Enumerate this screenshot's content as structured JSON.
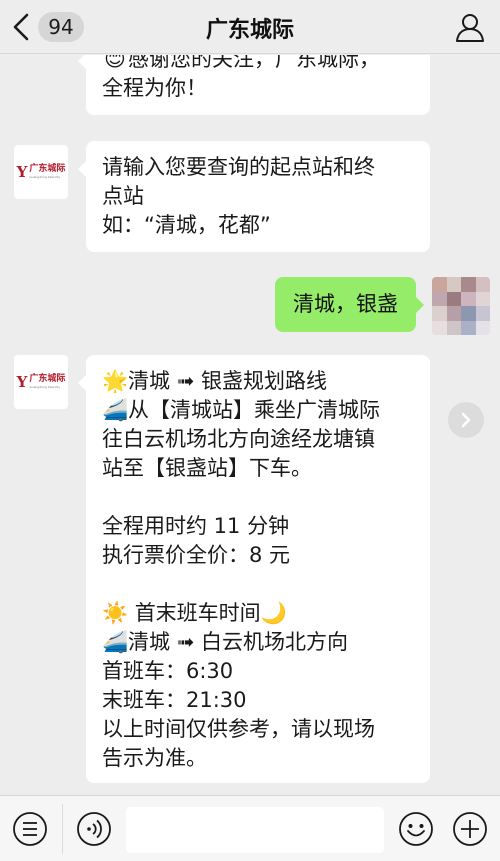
{
  "header": {
    "unread_count": "94",
    "title": "广东城际"
  },
  "messages": {
    "m1": {
      "line1": "感谢您的关注，广东城际，",
      "line2": "全程为你！"
    },
    "m2": {
      "sender_logo": "广东城际",
      "sender_logo_en": "Guangdong Intercity",
      "line1": "请输入您要查询的起点站和终",
      "line2": "点站",
      "line3": "如：“清城，花都”"
    },
    "m3": {
      "text": "清城，银盏"
    },
    "m4": {
      "sender_logo": "广东城际",
      "sender_logo_en": "Guangdong Intercity",
      "route_title": "清城 ➟ 银盏规划路线",
      "route_line1": "从【清城站】乘坐广清城际",
      "route_line2": "往白云机场北方向途经龙塘镇",
      "route_line3": "站至【银盏站】下车。",
      "duration": "全程用时约 11 分钟",
      "fare": "执行票价全价：8 元",
      "schedule_title": "首末班车时间",
      "direction": "清城 ➟ 白云机场北方向",
      "first_train": "首班车：6:30",
      "last_train": "末班车：21:30",
      "note_line1": "以上时间仅供参考，请以现场",
      "note_line2": "告示为准。"
    }
  },
  "icons": {
    "back": "chevron-left-icon",
    "profile": "person-icon",
    "smile": "smile-emoji-icon",
    "star": "star-emoji-icon",
    "train": "train-emoji-icon",
    "sun": "sun-emoji-icon",
    "moon": "moon-emoji-icon",
    "share": "chevron-right-icon",
    "menu": "menu-icon",
    "voice": "voice-icon",
    "emoji": "emoji-icon",
    "plus": "plus-icon"
  },
  "colors": {
    "outgoing_bubble": "#95ec69",
    "incoming_bubble": "#ffffff",
    "background": "#ededed",
    "brand": "#b21b2b"
  },
  "composer": {
    "placeholder": ""
  }
}
